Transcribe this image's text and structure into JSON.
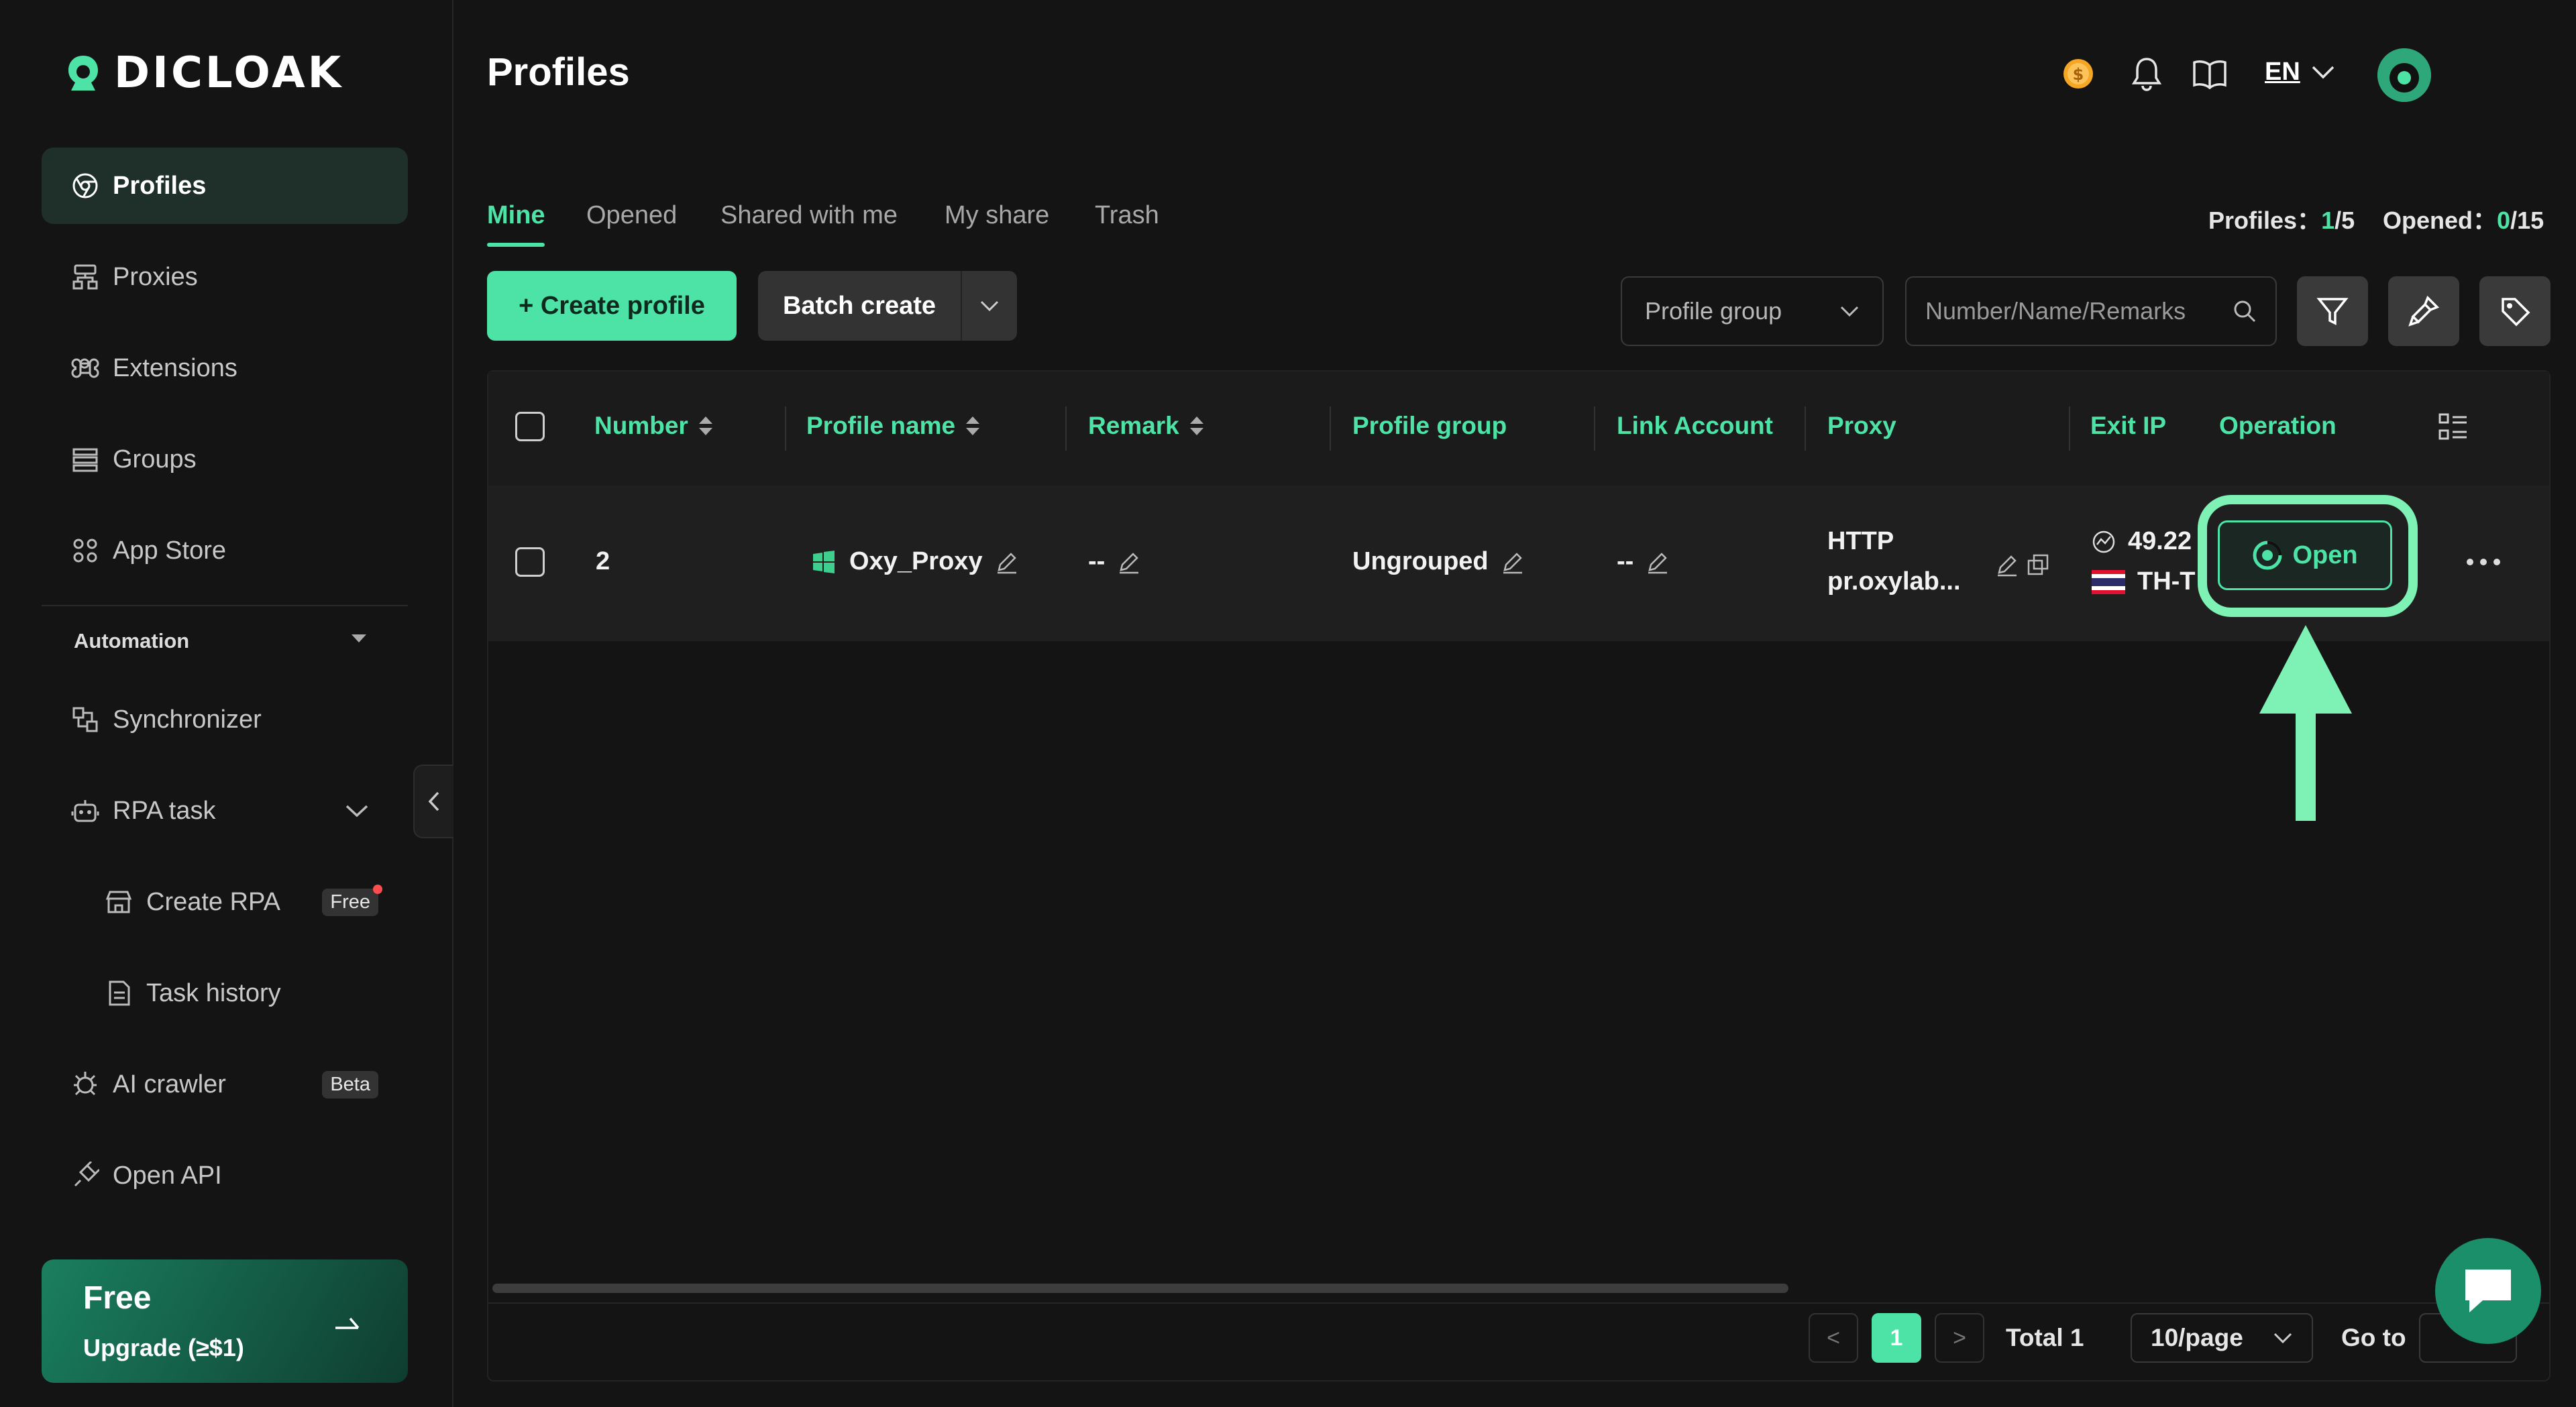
{
  "app": {
    "logo_text": "DICLOAK"
  },
  "sidebar": {
    "items": [
      {
        "label": "Profiles",
        "icon": "chrome-icon"
      },
      {
        "label": "Proxies",
        "icon": "network-icon"
      },
      {
        "label": "Extensions",
        "icon": "command-icon"
      },
      {
        "label": "Groups",
        "icon": "list-icon"
      },
      {
        "label": "App Store",
        "icon": "apps-icon"
      }
    ],
    "automation_label": "Automation",
    "automation_items": [
      {
        "label": "Synchronizer",
        "icon": "sync-icon"
      },
      {
        "label": "RPA task",
        "icon": "robot-icon"
      },
      {
        "label": "Create RPA",
        "icon": "store-icon",
        "badge": "Free"
      },
      {
        "label": "Task history",
        "icon": "document-icon"
      },
      {
        "label": "AI crawler",
        "icon": "bug-icon",
        "badge": "Beta"
      },
      {
        "label": "Open API",
        "icon": "plug-icon"
      }
    ],
    "upgrade": {
      "title": "Free",
      "subtitle": "Upgrade (≥$1)"
    }
  },
  "header": {
    "title": "Profiles",
    "language": "EN"
  },
  "tabs": [
    "Mine",
    "Opened",
    "Shared with me",
    "My share",
    "Trash"
  ],
  "counts": {
    "profiles_label": "Profiles：",
    "profiles_used": "1",
    "profiles_total": "/5",
    "opened_label": "Opened：",
    "opened_used": "0",
    "opened_total": "/15"
  },
  "toolbar": {
    "create_label": "+ Create profile",
    "batch_label": "Batch create",
    "group_placeholder": "Profile group",
    "search_placeholder": "Number/Name/Remarks"
  },
  "table": {
    "columns": [
      "Number",
      "Profile name",
      "Remark",
      "Profile group",
      "Link Account",
      "Proxy",
      "Exit IP",
      "Operation"
    ],
    "rows": [
      {
        "number": "2",
        "name": "Oxy_Proxy",
        "remark": "--",
        "group": "Ungrouped",
        "link_account": "--",
        "proxy_type": "HTTP",
        "proxy_host": "pr.oxylab...",
        "exit_ip": "49.22",
        "exit_region": "TH-T",
        "operation": "Open"
      }
    ]
  },
  "pagination": {
    "prev": "<",
    "current": "1",
    "next": ">",
    "total": "Total 1",
    "page_size": "10/page",
    "goto_label": "Go to"
  },
  "colors": {
    "accent": "#4ee3a6",
    "highlight": "#7ef2b4",
    "background": "#141414"
  }
}
